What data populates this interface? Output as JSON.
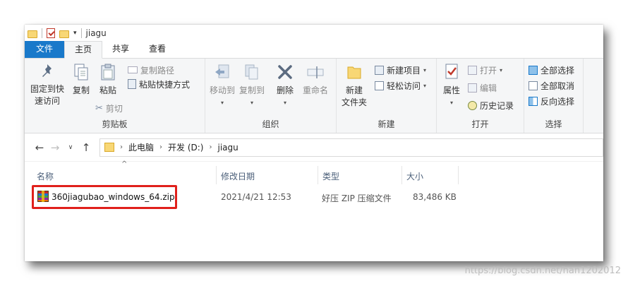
{
  "window": {
    "title": "jiagu"
  },
  "tabs": [
    {
      "label": "文件"
    },
    {
      "label": "主页"
    },
    {
      "label": "共享"
    },
    {
      "label": "查看"
    }
  ],
  "ribbon": {
    "clipboard": {
      "label": "剪贴板",
      "pin_line1": "固定到快",
      "pin_line2": "速访问",
      "copy": "复制",
      "paste": "粘贴",
      "copy_path": "复制路径",
      "paste_shortcut": "粘贴快捷方式",
      "cut": "剪切"
    },
    "organize": {
      "label": "组织",
      "move_to": "移动到",
      "copy_to": "复制到",
      "delete": "删除",
      "rename": "重命名"
    },
    "new": {
      "label": "新建",
      "new_folder_line1": "新建",
      "new_folder_line2": "文件夹",
      "new_item": "新建项目",
      "easy_access": "轻松访问"
    },
    "open": {
      "label": "打开",
      "properties": "属性",
      "open": "打开",
      "edit": "编辑",
      "history": "历史记录"
    },
    "select": {
      "label": "选择",
      "select_all": "全部选择",
      "select_none": "全部取消",
      "invert": "反向选择"
    }
  },
  "address": {
    "crumbs": [
      "此电脑",
      "开发 (D:)",
      "jiagu"
    ]
  },
  "columns": {
    "name": "名称",
    "modified": "修改日期",
    "type": "类型",
    "size": "大小"
  },
  "files": [
    {
      "name": "360jiagubao_windows_64.zip",
      "modified": "2021/4/21 12:53",
      "type": "好压 ZIP 压缩文件",
      "size": "83,486 KB"
    }
  ],
  "watermark": "https://blog.csdn.net/han1202012",
  "colors": {
    "accent": "#1979ca",
    "highlight": "#e0201b"
  }
}
